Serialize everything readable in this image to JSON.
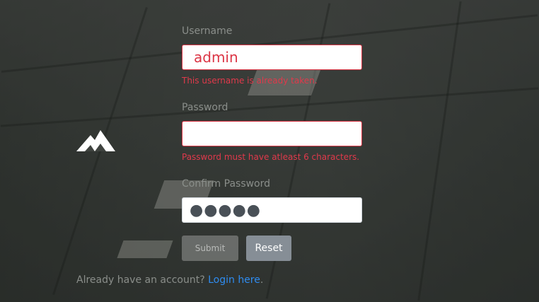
{
  "form": {
    "username_label": "Username",
    "username_value": "admin",
    "username_error": "This username is already taken.",
    "password_label": "Password",
    "password_value": "",
    "password_error": "Password must have atleast 6 characters.",
    "confirm_label": "Confirm Password",
    "confirm_value": "●●●●●",
    "submit_label": "Submit",
    "reset_label": "Reset"
  },
  "footer": {
    "prompt": "Already have an account?",
    "link": "Login here",
    "end": "."
  },
  "logo": {
    "icon": "mountain-icon",
    "color": "#ffffff"
  },
  "colors": {
    "error": "#dc3545",
    "link": "#2f8cf0",
    "label": "#8a8e8a"
  }
}
